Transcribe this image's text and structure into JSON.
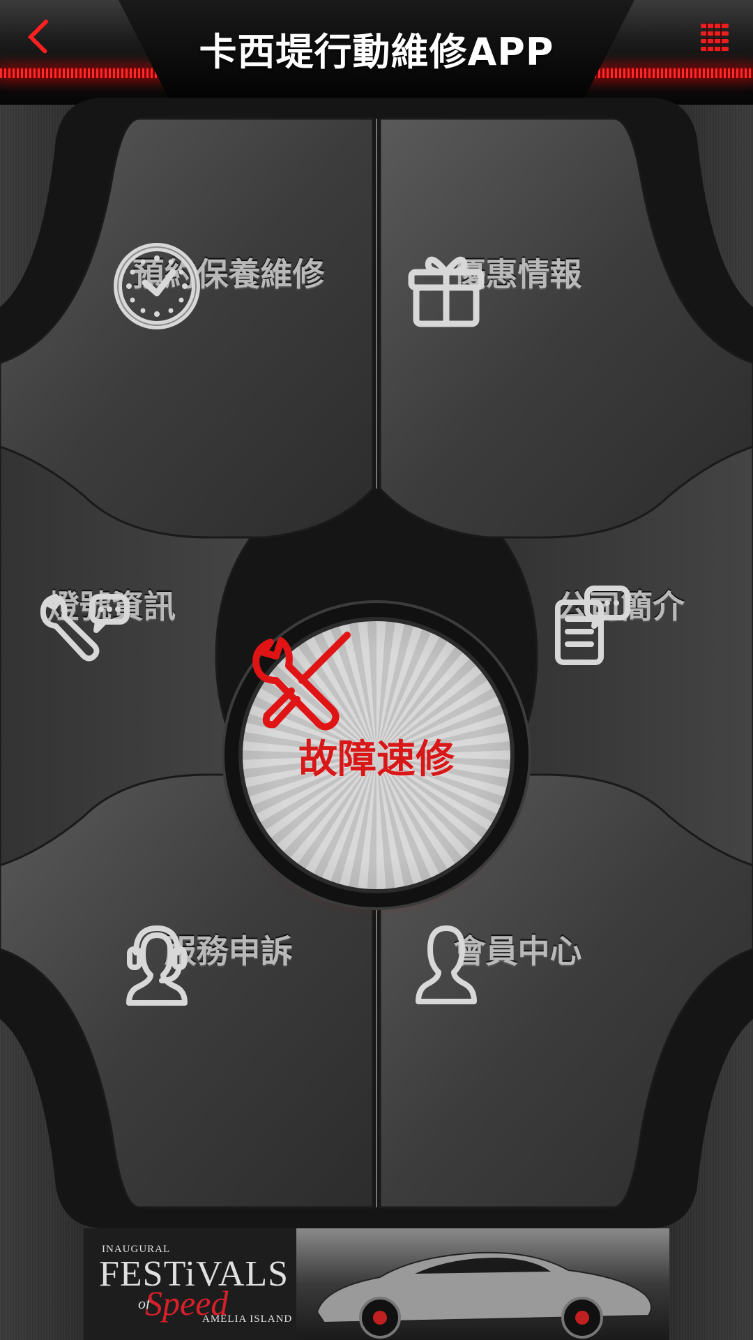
{
  "header": {
    "title": "卡西堤行動維修APP",
    "back_icon": "chevron-left-icon",
    "menu_icon": "menu-icon",
    "accent_color": "#ff1a1a"
  },
  "menu": {
    "items": [
      {
        "label": "預約保養維修",
        "icon": "clock-icon"
      },
      {
        "label": "優惠情報",
        "icon": "gift-icon"
      },
      {
        "label": "燈號資訊",
        "icon": "wrench-chat-icon"
      },
      {
        "label": "公司簡介",
        "icon": "document-chat-icon"
      },
      {
        "label": "服務申訴",
        "icon": "headset-person-icon"
      },
      {
        "label": "會員中心",
        "icon": "person-icon"
      }
    ],
    "center": {
      "label": "故障速修",
      "icon": "tools-icon",
      "color": "#d81818"
    }
  },
  "ad": {
    "line1": "INAUGURAL",
    "line2": "FESTiVALS",
    "line3": "of",
    "line4": "Speed",
    "line5": "AMELIA ISLAND"
  }
}
